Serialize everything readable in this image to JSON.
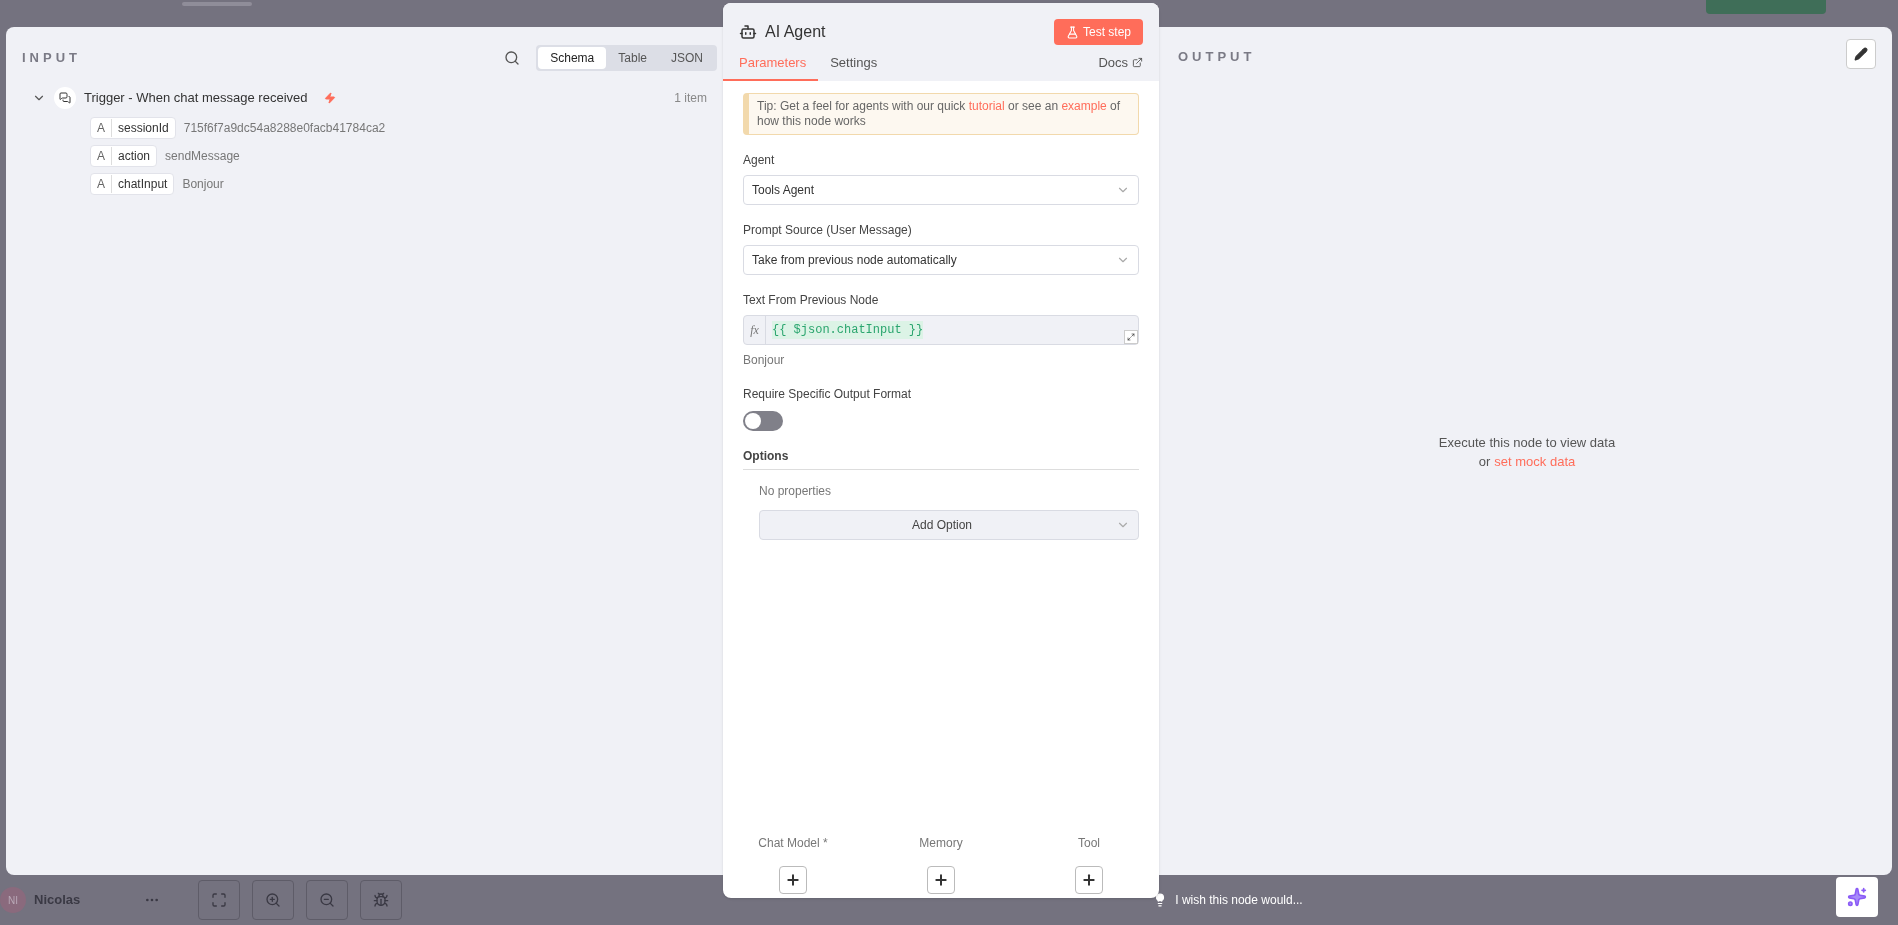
{
  "input": {
    "title": "INPUT",
    "view_tabs": [
      {
        "label": "Schema",
        "selected": true
      },
      {
        "label": "Table",
        "selected": false
      },
      {
        "label": "JSON",
        "selected": false
      }
    ],
    "node": {
      "name": "Trigger - When chat message received",
      "expanded": true,
      "count": "1 item",
      "fields": [
        {
          "type": "A",
          "key": "sessionId",
          "value": "715f6f7a9dc54a8288e0facb41784ca2"
        },
        {
          "type": "A",
          "key": "action",
          "value": "sendMessage"
        },
        {
          "type": "A",
          "key": "chatInput",
          "value": "Bonjour"
        }
      ]
    }
  },
  "node_panel": {
    "title": "AI Agent",
    "test_button": "Test step",
    "tabs": [
      {
        "label": "Parameters",
        "selected": true
      },
      {
        "label": "Settings",
        "selected": false
      }
    ],
    "docs_link": "Docs",
    "tip": [
      {
        "text": "Tip: Get a feel for agents with our quick ",
        "link": false
      },
      {
        "text": "tutorial",
        "link": true
      },
      {
        "text": " or see an ",
        "link": false
      },
      {
        "text": "example",
        "link": true
      },
      {
        "text": " of how this node works",
        "link": false
      }
    ],
    "agent": {
      "label": "Agent",
      "value": "Tools Agent"
    },
    "prompt_source": {
      "label": "Prompt Source (User Message)",
      "value": "Take from previous node automatically"
    },
    "text_field": {
      "label": "Text From Previous Node",
      "prefix": "fx",
      "expression": "{{ $json.chatInput }}",
      "result": "Bonjour"
    },
    "output_format": {
      "label": "Require Specific Output Format",
      "on": false
    },
    "options": {
      "title": "Options",
      "empty": "No properties",
      "add_button": "Add Option"
    },
    "connectors": [
      {
        "label": "Chat Model *"
      },
      {
        "label": "Memory"
      },
      {
        "label": "Tool"
      }
    ]
  },
  "output": {
    "title": "OUTPUT",
    "empty_text": "Execute this node to view data",
    "or": "or",
    "mock_link": "set mock data"
  },
  "bottom": {
    "user": {
      "initials": "NI",
      "name": "Nicolas"
    },
    "feedback": "I wish this node would..."
  }
}
